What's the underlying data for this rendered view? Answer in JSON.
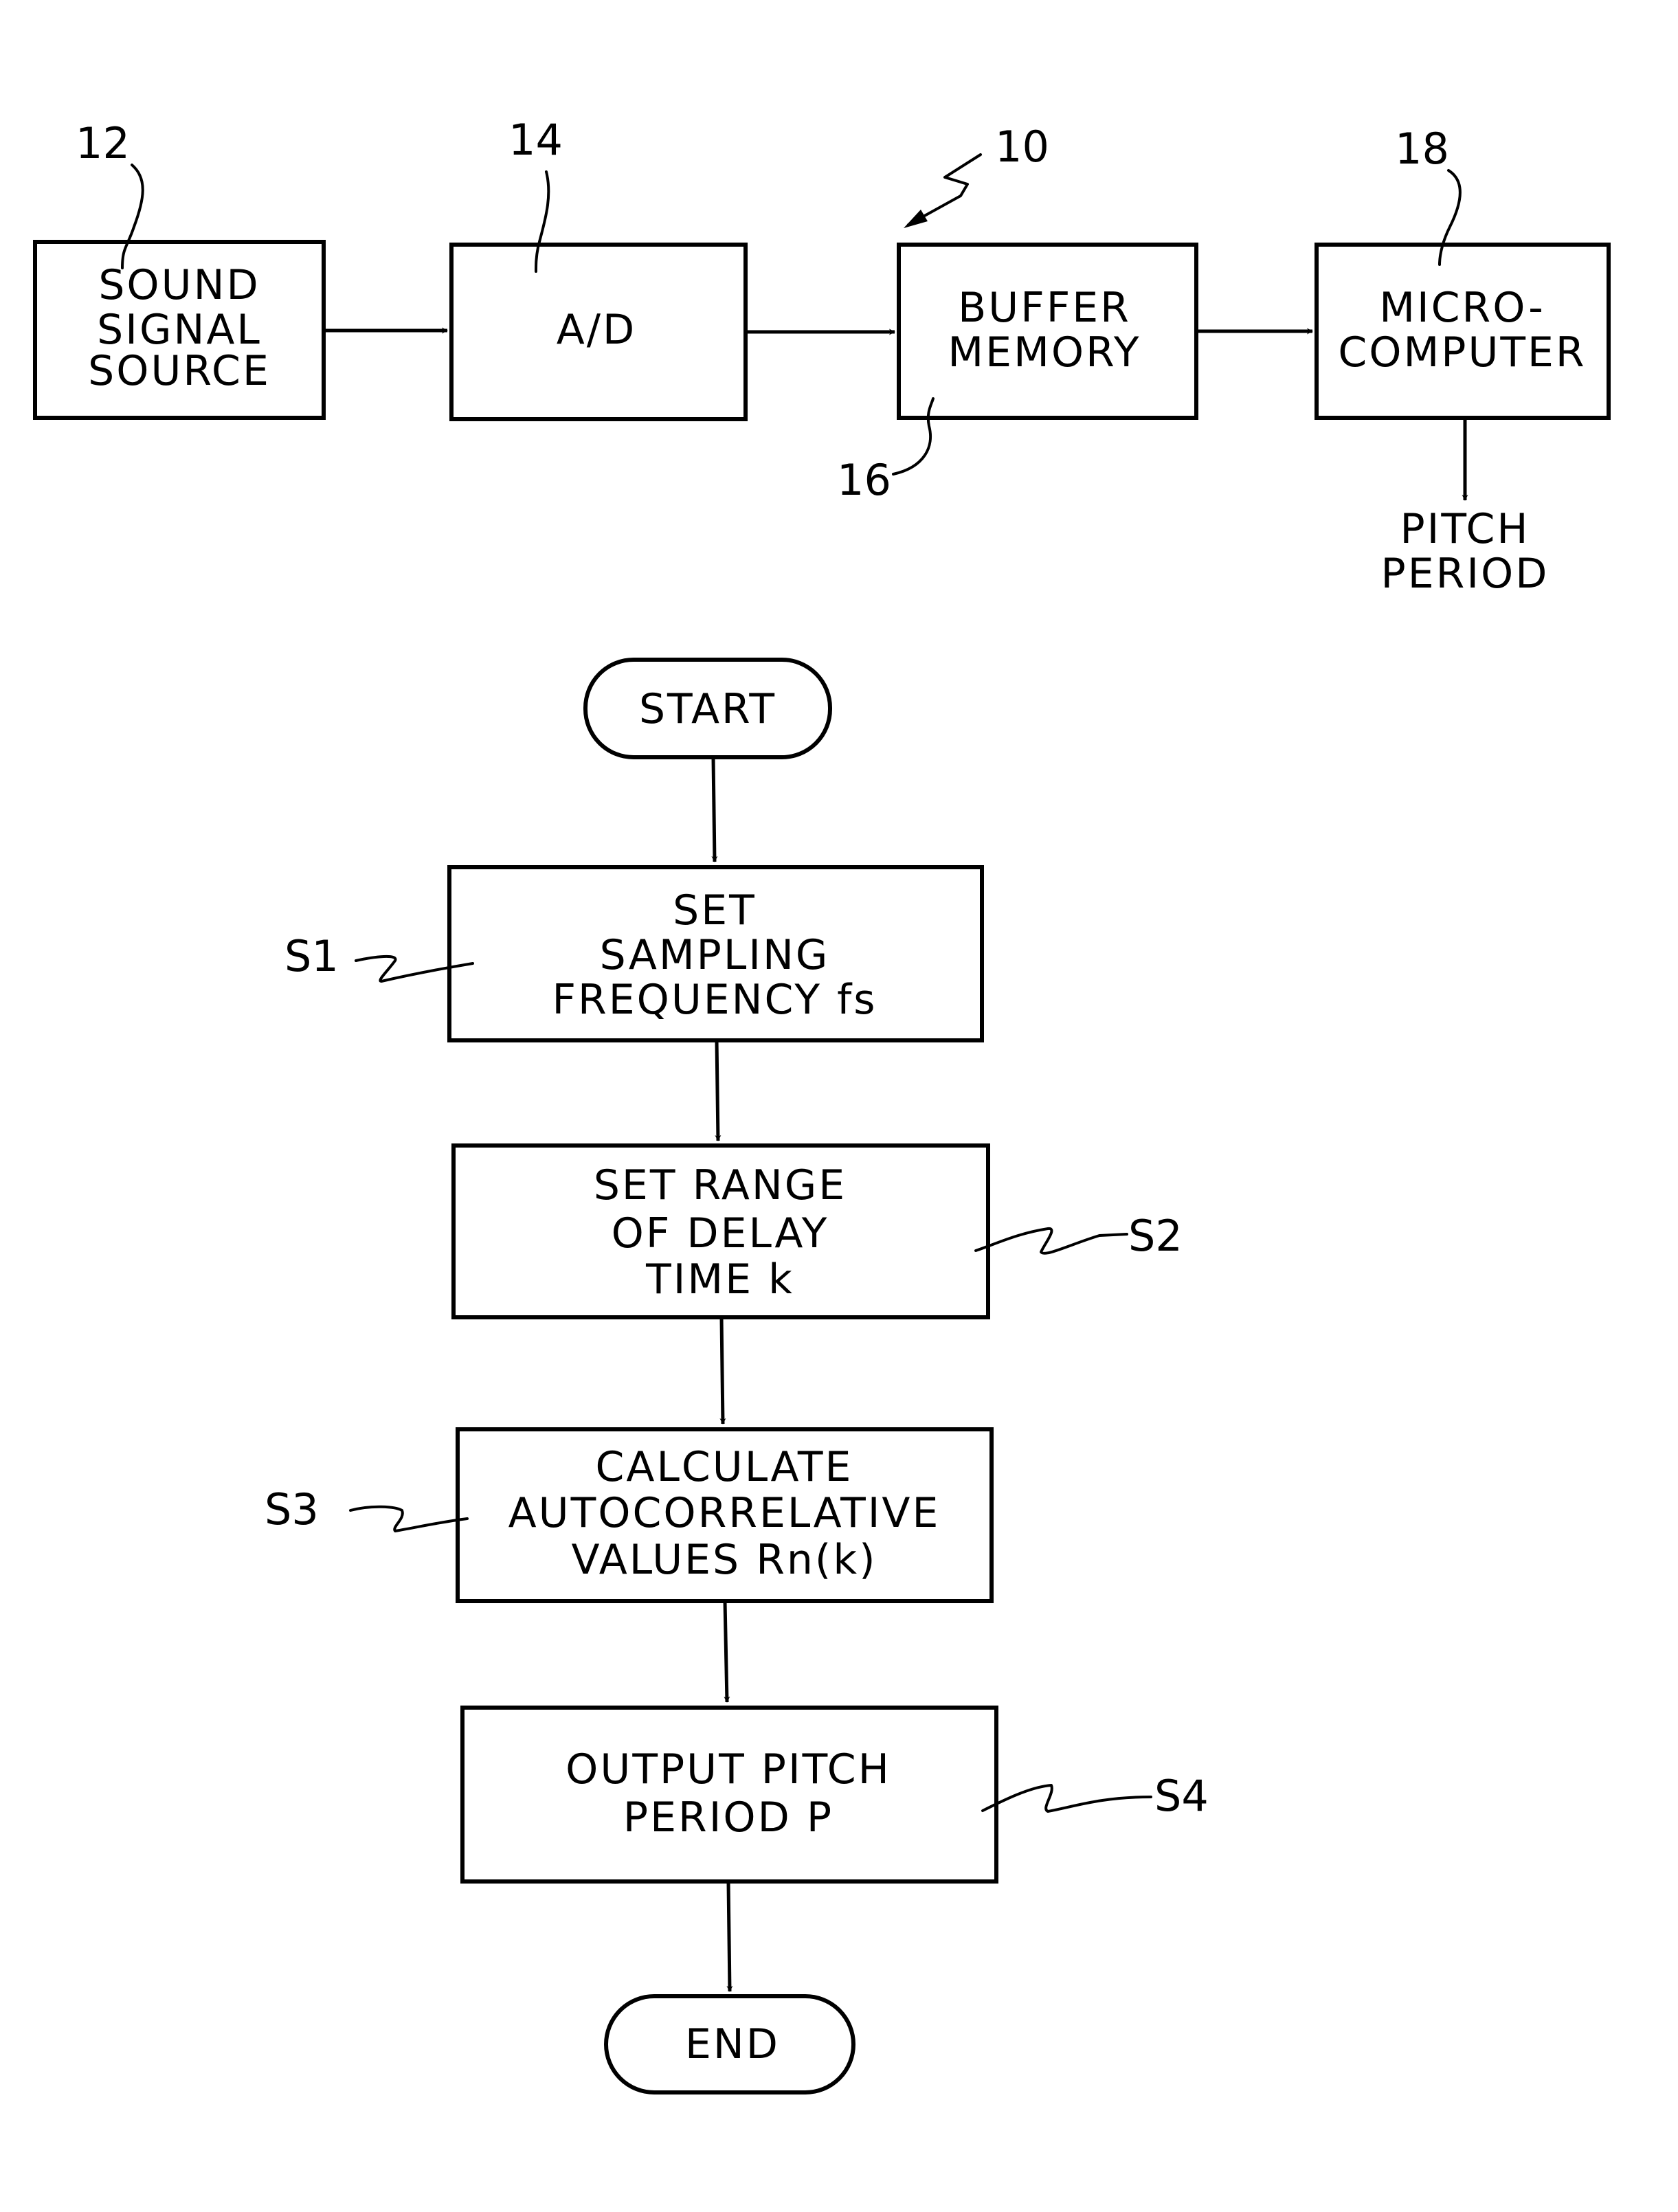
{
  "block_diagram": {
    "system_ref": "10",
    "blocks": [
      {
        "ref": "12",
        "lines": [
          "SOUND",
          "SIGNAL",
          "SOURCE"
        ]
      },
      {
        "ref": "14",
        "lines": [
          "A/D"
        ]
      },
      {
        "ref": "16",
        "lines": [
          "BUFFER",
          "MEMORY"
        ]
      },
      {
        "ref": "18",
        "lines": [
          "MICRO-",
          "COMPUTER"
        ]
      }
    ],
    "output_label": [
      "PITCH",
      "PERIOD"
    ]
  },
  "flowchart": {
    "start": "START",
    "end": "END",
    "steps": [
      {
        "id": "S1",
        "lines": [
          "SET",
          "SAMPLING",
          "FREQUENCY fs"
        ]
      },
      {
        "id": "S2",
        "lines": [
          "SET RANGE",
          "OF DELAY",
          "TIME k"
        ]
      },
      {
        "id": "S3",
        "lines": [
          "CALCULATE",
          "AUTOCORRELATIVE",
          "VALUES Rn(k)"
        ]
      },
      {
        "id": "S4",
        "lines": [
          "OUTPUT PITCH",
          "PERIOD P"
        ]
      }
    ]
  }
}
